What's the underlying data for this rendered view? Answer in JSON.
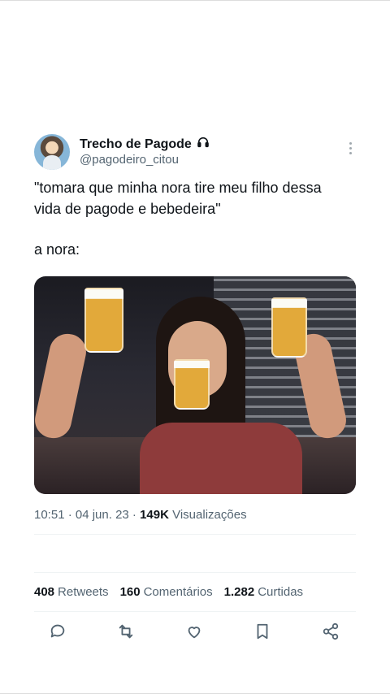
{
  "author": {
    "display_name": "Trecho de Pagode",
    "handle": "@pagodeiro_citou",
    "badge_icon": "headphones-icon"
  },
  "tweet": {
    "line1": "\"tomara que minha nora tire meu filho dessa",
    "line2": "vida de pagode e bebedeira\"",
    "line3": "a nora:"
  },
  "meta": {
    "time_date": "10:51 · 04 jun. 23 · ",
    "views_count": "149K",
    "views_label": " Visualizações"
  },
  "stats": {
    "retweets_count": "408",
    "retweets_label": "Retweets",
    "comments_count": "160",
    "comments_label": "Comentários",
    "likes_count": "1.282",
    "likes_label": "Curtidas"
  },
  "colors": {
    "text": "#0f1419",
    "secondary": "#536471"
  }
}
